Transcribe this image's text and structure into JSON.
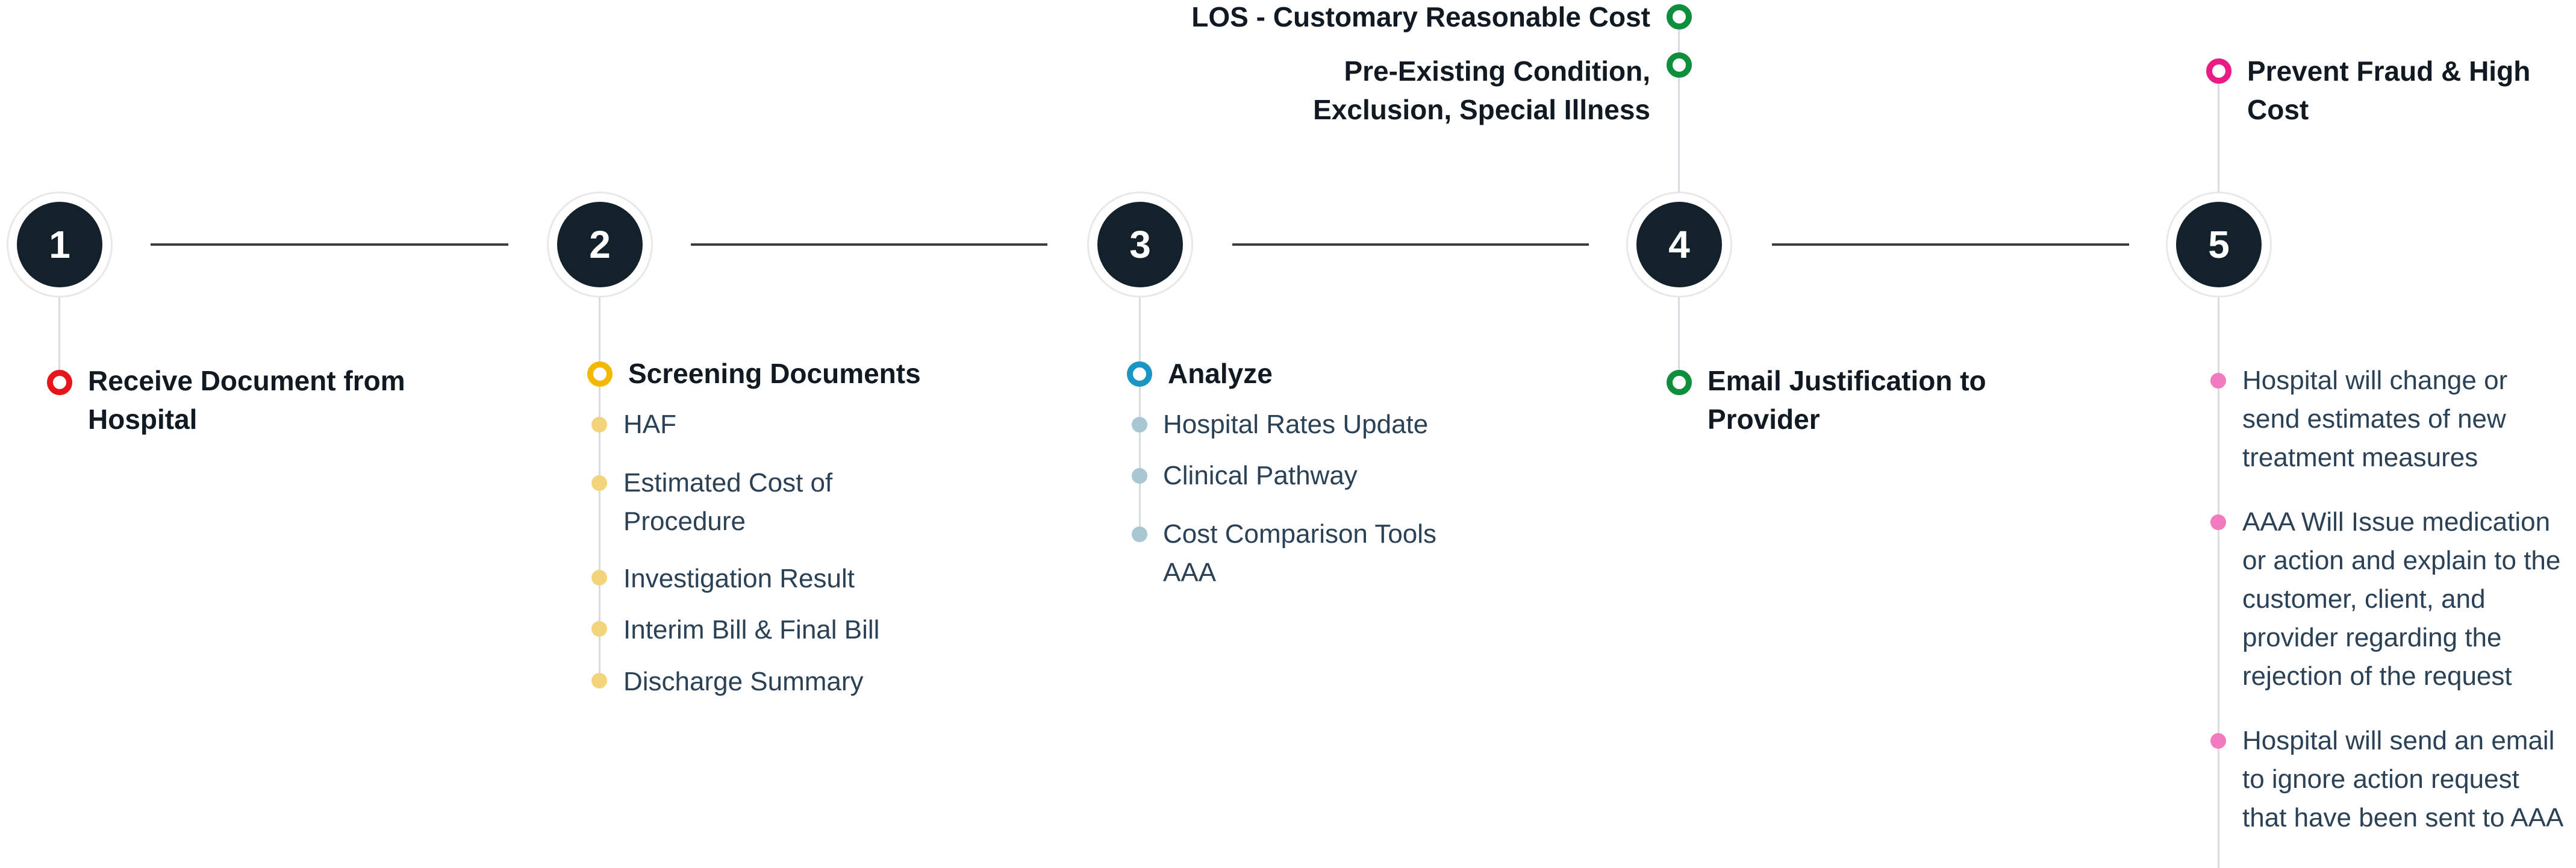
{
  "steps": [
    {
      "number": "1",
      "below": {
        "title": "Receive Document from Hospital",
        "ring_color": "#e8141c",
        "items": []
      },
      "above": []
    },
    {
      "number": "2",
      "below": {
        "title": "Screening Documents",
        "ring_color": "#f5b800",
        "dot_color": "#f2d57a",
        "items": [
          "HAF",
          "Estimated Cost of Procedure",
          "Investigation Result",
          "Interim Bill & Final Bill",
          "Discharge Summary"
        ]
      },
      "above": []
    },
    {
      "number": "3",
      "below": {
        "title": "Analyze",
        "ring_color": "#1b96c4",
        "dot_color": "#a8c7d2",
        "items": [
          "Hospital Rates Update",
          "Clinical Pathway",
          "Cost Comparison Tools AAA"
        ]
      },
      "above": []
    },
    {
      "number": "4",
      "below": {
        "title": "Email Justification to Provider",
        "ring_color": "#0f8f3d",
        "items": []
      },
      "above": [
        {
          "title": "LOS - Customary Reasonable Cost",
          "ring_color": "#0f8f3d"
        },
        {
          "title": "Pre-Existing Condition, Exclusion, Special Illness",
          "ring_color": "#0f8f3d"
        }
      ]
    },
    {
      "number": "5",
      "below": {
        "title": "",
        "dot_color": "#f27bbf",
        "items": [
          "Hospital will change or send estimates of new treatment measures",
          "AAA Will Issue medication or action and explain to the customer, client, and provider regarding the rejection of the request",
          "Hospital will send an email to ignore action request that have been sent to AAA"
        ]
      },
      "above": [
        {
          "title": "Prevent Fraud & High Cost",
          "ring_color": "#ea1b85"
        }
      ]
    }
  ]
}
